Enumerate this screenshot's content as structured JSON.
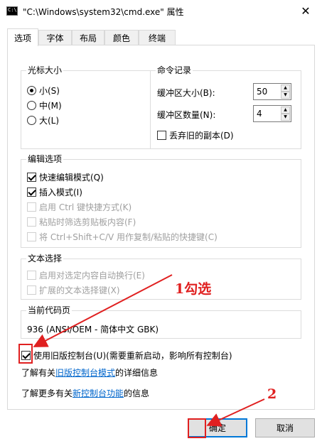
{
  "window": {
    "title": "\"C:\\Windows\\system32\\cmd.exe\" 属性",
    "close_glyph": "✕",
    "icon": "console-icon"
  },
  "tabs": [
    {
      "label": "选项",
      "active": true
    },
    {
      "label": "字体",
      "active": false
    },
    {
      "label": "布局",
      "active": false
    },
    {
      "label": "颜色",
      "active": false
    },
    {
      "label": "终端",
      "active": false
    }
  ],
  "cursor_size": {
    "title": "光标大小",
    "options": [
      {
        "label": "小(S)",
        "selected": true
      },
      {
        "label": "中(M)",
        "selected": false
      },
      {
        "label": "大(L)",
        "selected": false
      }
    ]
  },
  "command_history": {
    "title": "命令记录",
    "buffer_size_label": "缓冲区大小(B):",
    "buffer_size_value": "50",
    "buffer_count_label": "缓冲区数量(N):",
    "buffer_count_value": "4",
    "discard_duplicates_label": "丢弃旧的副本(D)",
    "discard_duplicates_checked": false
  },
  "edit_options": {
    "title": "编辑选项",
    "items": [
      {
        "label": "快速编辑模式(Q)",
        "checked": true,
        "enabled": true
      },
      {
        "label": "插入模式(I)",
        "checked": true,
        "enabled": true
      },
      {
        "label": "启用 Ctrl 键快捷方式(K)",
        "checked": false,
        "enabled": false
      },
      {
        "label": "粘贴时筛选剪贴板内容(F)",
        "checked": false,
        "enabled": false
      },
      {
        "label": "将 Ctrl+Shift+C/V 用作复制/粘贴的快捷键(C)",
        "checked": false,
        "enabled": false
      }
    ]
  },
  "text_selection": {
    "title": "文本选择",
    "items": [
      {
        "label": "启用对选定内容自动换行(E)",
        "checked": false,
        "enabled": false
      },
      {
        "label": "扩展的文本选择键(X)",
        "checked": false,
        "enabled": false
      }
    ]
  },
  "codepage": {
    "title": "当前代码页",
    "value": "936   (ANSI/OEM - 简体中文 GBK)"
  },
  "legacy_console": {
    "label": "使用旧版控制台(U)(需要重新启动，影响所有控制台)",
    "checked": true
  },
  "learn_legacy": {
    "prefix": "了解有关",
    "link": "旧版控制台模式",
    "suffix": "的详细信息"
  },
  "learn_new": {
    "prefix": "了解更多有关",
    "link": "新控制台功能",
    "suffix": "的信息"
  },
  "buttons": {
    "ok": "确定",
    "cancel": "取消"
  },
  "annotations": {
    "step1": "1勾选",
    "step2": "2",
    "color": "#e02020"
  }
}
